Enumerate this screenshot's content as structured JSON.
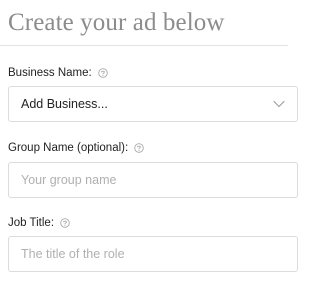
{
  "heading": "Create your ad below",
  "business": {
    "label": "Business Name:",
    "selected": "Add Business..."
  },
  "group": {
    "label": "Group Name (optional):",
    "placeholder": "Your group name",
    "value": ""
  },
  "job": {
    "label": "Job Title:",
    "placeholder": "The title of the role",
    "value": ""
  },
  "icons": {
    "help": "question-circle-icon",
    "dropdown": "chevron-down-icon"
  },
  "colors": {
    "heading": "#8c8c8c",
    "border": "#dcdcdc",
    "placeholder": "#b0b0b0",
    "icon": "#a8a8a8"
  }
}
